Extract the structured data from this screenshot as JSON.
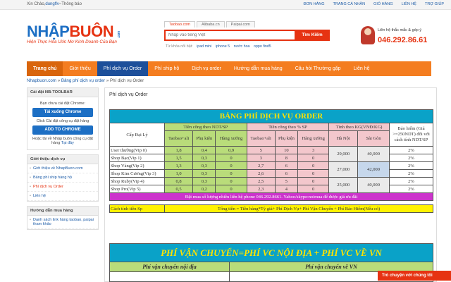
{
  "topbar": {
    "greeting": "Xin Chào,",
    "user": "dungflv",
    "notice": "~Thông báo",
    "links": [
      "ĐƠN HÀNG",
      "TRANG CÁ NHÂN",
      "GIỎ HÀNG",
      "LIÊN HỆ",
      "TRỢ GIÚP"
    ]
  },
  "brand": {
    "logo_a": "NHẬP",
    "logo_b": "BUÔN",
    "logo_dom": ".com",
    "slogan": "Hiện Thực Hóa Ước Mơ Kinh Doanh Của Bạn"
  },
  "search": {
    "tabs": [
      "Taobao.com",
      "Alibaba.cn",
      "Paipai.com"
    ],
    "placeholder": "Nhập vào tiếng Việt",
    "button": "Tìm Kiếm",
    "hint_label": "Từ khóa nổi bật:",
    "hint_words": [
      "ipad mini",
      "iphone 5",
      "nước hoa",
      "oppo find5"
    ]
  },
  "contact": {
    "label": "Liên hệ thắc mắc & góp ý",
    "phone": "046.292.86.61"
  },
  "nav": [
    "Trang chủ",
    "Giới thiệu",
    "Phí dịch vụ Order",
    "Phí ship hộ",
    "Dịch vụ order",
    "Hướng dẫn mua hàng",
    "Câu hỏi Thường gặp",
    "Liên hệ"
  ],
  "breadcrumb": {
    "home": "Nhapbuon.com",
    "sep": " » ",
    "parent": "Bảng phí dịch vụ order",
    "current": "» Phí dịch vụ Order"
  },
  "sidebar": {
    "toolbar_head": "Cài đặt NB-TOOLBAR",
    "toolbar_q": "Bạn chưa cài đặt Chrome:",
    "toolbar_btn1": "Tải xuống Chrome",
    "toolbar_q2": "Click Cài đặt công cụ đặt hàng",
    "toolbar_btn2": "ADD TO CHROME",
    "toolbar_help_a": "Hoặc tải về",
    "toolbar_help_b": "Nhập buôn công cụ đặt hàng",
    "toolbar_help_c": "Tại đây",
    "intro_head": "Giới thiệu dịch vụ",
    "intro_items": [
      "Giới thiệu về NhapBuon.com",
      "Bảng phí ship hàng hộ",
      "Phí dịch vụ Order",
      "Liên hệ"
    ],
    "guide_head": "Hướng dẫn mua hàng",
    "guide_items": [
      "Danh sách link hàng taobao, paipai tham khảo"
    ]
  },
  "main": {
    "title": "Phí dịch vụ Order",
    "table_title": "BẢNG PHÍ DỊCH VỤ ORDER",
    "col_level": "Cấp Đại Lý",
    "col_ndt": "Tiền công theo NDT/SP",
    "col_pct": "Tiền công theo % SP",
    "col_weight": "Tính theo KG(VNĐ/KG)",
    "col_ins": "Bảo hiểm (Giá >=250NDT) đối với cách tính NDT/SP",
    "sub_cols": [
      "Taobao+ali",
      "Phụ kiện",
      "Hàng xưởng",
      "Taobao+ali",
      "Phụ kiện",
      "Hàng xưởng",
      "Hà Nội",
      "Sài Gòn"
    ],
    "rows": [
      {
        "name": "User thường(Vip 0)",
        "v": [
          "1,8",
          "0,4",
          "0,9",
          "5",
          "10",
          "3"
        ],
        "ins": "2%"
      },
      {
        "name": "Shop Bạc(Vip 1)",
        "v": [
          "1,5",
          "0,3",
          "0",
          "3",
          "8",
          "0"
        ],
        "ins": "2%"
      },
      {
        "name": "Shop Vàng(Vip 2)",
        "v": [
          "1,3",
          "0,3",
          "0",
          "2,7",
          "6",
          "0"
        ],
        "ins": "2%"
      },
      {
        "name": "Shop Kim Cương(Vip 3)",
        "v": [
          "1,0",
          "0,3",
          "0",
          "2,6",
          "6",
          "0"
        ],
        "ins": "2%"
      },
      {
        "name": "Shop Ruby(Vip 4)",
        "v": [
          "0,8",
          "0,3",
          "0",
          "2,5",
          "5",
          "0"
        ],
        "ins": "2%"
      },
      {
        "name": "Shop Pro(Vip 5)",
        "v": [
          "0,5",
          "0,2",
          "0",
          "2,3",
          "4",
          "0"
        ],
        "ins": "2%"
      }
    ],
    "weights": [
      {
        "hn": "29,000",
        "sg": "40,000"
      },
      {
        "hn": "27,000",
        "sg": "42,000"
      },
      {
        "hn": "25,000",
        "sg": "40,000"
      }
    ],
    "note": "Đặt mua số lượng nhiều liên hệ phone 046.292.8661. Yahoo/skype:noimua để được giá ưu đãi",
    "calc_label": "Cách tính tiền Sp",
    "calc_formula": "Tổng tiền = Tiền hàng*Tỷ giá+ Phí Dịch Vụ+ Phí Vận Chuyển + Phí Bảo Hiểm(Nếu có)",
    "ship_title": "PHÍ VẬN CHUYỂN=PHÍ VC NỘI ĐỊA + PHÍ VC VỀ VN",
    "ship_left": "Phí vận chuyển nội địa",
    "ship_right": "Phí vận chuyển về VN"
  },
  "chat": "Trò chuyện với chúng tôi"
}
